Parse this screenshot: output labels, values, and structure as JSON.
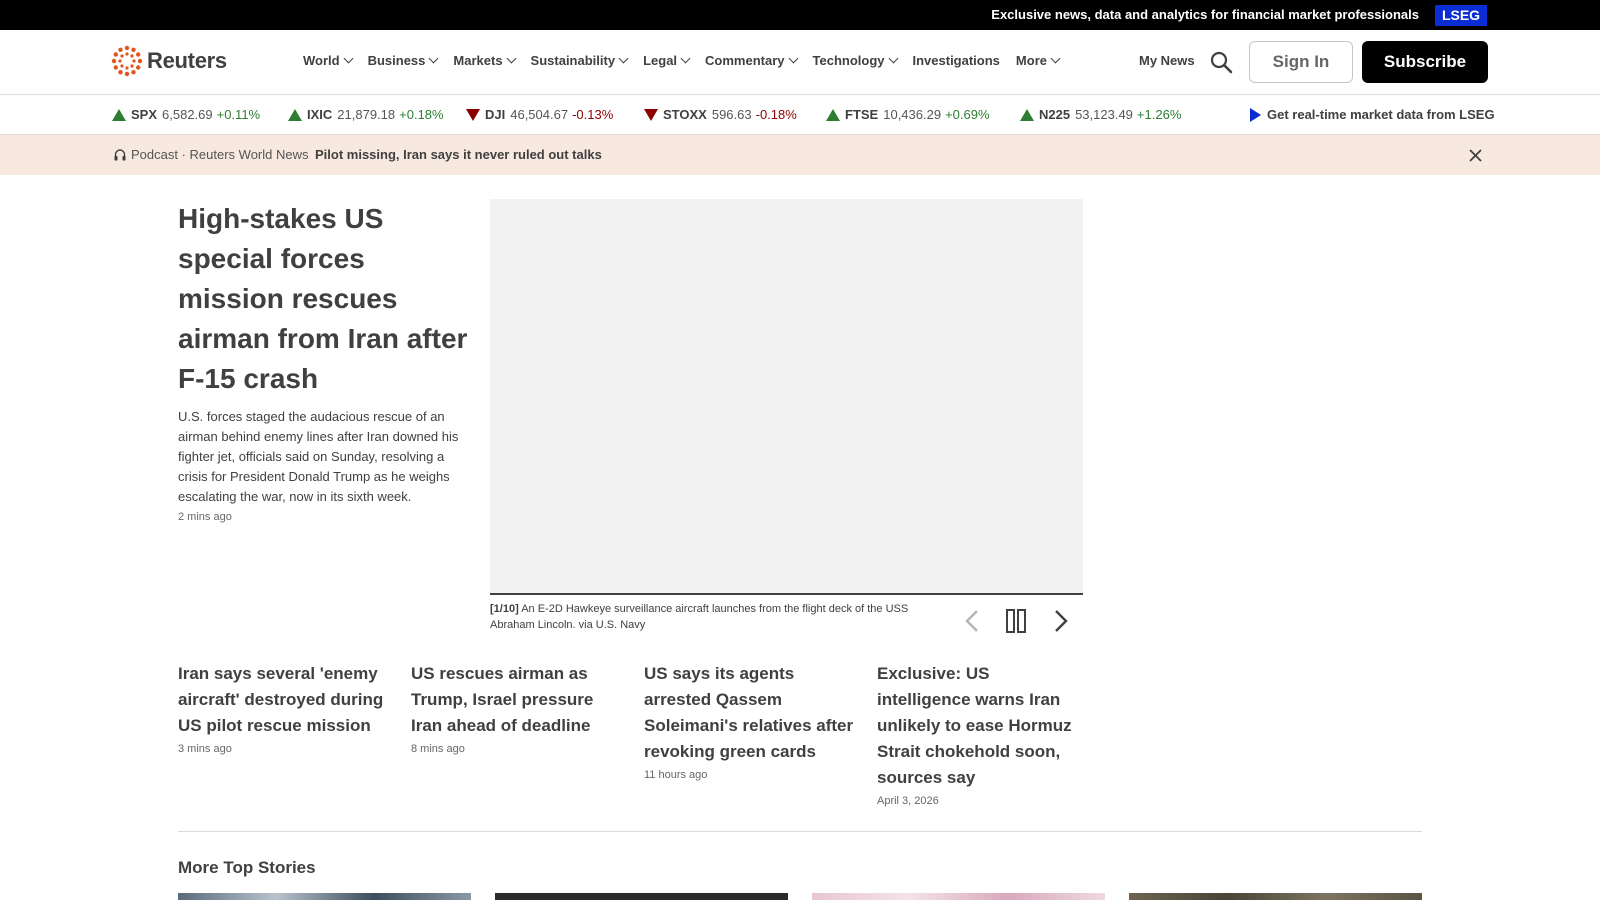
{
  "topbar": {
    "text": "Exclusive news, data and analytics for financial market professionals",
    "badge": "LSEG"
  },
  "header": {
    "logo_text": "Reuters",
    "nav": [
      {
        "label": "World",
        "has_dropdown": true
      },
      {
        "label": "Business",
        "has_dropdown": true
      },
      {
        "label": "Markets",
        "has_dropdown": true
      },
      {
        "label": "Sustainability",
        "has_dropdown": true
      },
      {
        "label": "Legal",
        "has_dropdown": true
      },
      {
        "label": "Commentary",
        "has_dropdown": true
      },
      {
        "label": "Technology",
        "has_dropdown": true
      },
      {
        "label": "Investigations",
        "has_dropdown": false
      },
      {
        "label": "More",
        "has_dropdown": true
      }
    ],
    "my_news": "My News",
    "sign_in": "Sign In",
    "subscribe": "Subscribe"
  },
  "ticker": {
    "items": [
      {
        "symbol": "SPX",
        "value": "6,582.69",
        "change": "+0.11%",
        "direction": "up"
      },
      {
        "symbol": "IXIC",
        "value": "21,879.18",
        "change": "+0.18%",
        "direction": "up"
      },
      {
        "symbol": "DJI",
        "value": "46,504.67",
        "change": "-0.13%",
        "direction": "down"
      },
      {
        "symbol": "STOXX",
        "value": "596.63",
        "change": "-0.18%",
        "direction": "down"
      },
      {
        "symbol": "FTSE",
        "value": "10,436.29",
        "change": "+0.69%",
        "direction": "up"
      },
      {
        "symbol": "N225",
        "value": "53,123.49",
        "change": "+1.26%",
        "direction": "up"
      }
    ],
    "lseg_link": "Get real-time market data from LSEG"
  },
  "podcast": {
    "label": "Podcast · Reuters World News",
    "title": "Pilot missing, Iran says it never ruled out talks"
  },
  "hero": {
    "title": "High-stakes US special forces mission rescues airman from Iran after F-15 crash",
    "description": "U.S. forces staged the audacious rescue of an airman behind enemy lines after Iran downed his fighter jet, officials said on Sunday, resolving a crisis for President Donald Trump as he weighs escalating the war, now in its sixth week.",
    "time": "2 mins ago",
    "caption_index": "[1/10]",
    "caption_text": "An E-2D Hawkeye surveillance aircraft launches from the flight deck of the USS Abraham Lincoln. via U.S. Navy"
  },
  "stories": [
    {
      "title": "Iran says several 'enemy aircraft' destroyed during US pilot rescue mission",
      "time": "3 mins ago"
    },
    {
      "title": "US rescues airman as Trump, Israel pressure Iran ahead of deadline",
      "time": "8 mins ago"
    },
    {
      "title": "US says its agents arrested Qassem Soleimani's relatives after revoking green cards",
      "time": "11 hours ago"
    },
    {
      "title": "Exclusive: US intelligence warns Iran unlikely to ease Hormuz Strait chokehold soon, sources say",
      "time": "April 3, 2026"
    }
  ],
  "more": {
    "title": "More Top Stories"
  },
  "colors": {
    "up": "#2e7d32",
    "down": "#8b0000",
    "lseg_blue": "#0a2dd6",
    "banner_bg": "#f7e9df"
  },
  "icons": [
    "reuters-logo-icon",
    "chevron-down-icon",
    "search-icon",
    "triangle-up-icon",
    "triangle-down-icon",
    "play-icon",
    "headphones-icon",
    "close-icon",
    "chevron-left-icon",
    "pause-icon",
    "chevron-right-icon"
  ]
}
